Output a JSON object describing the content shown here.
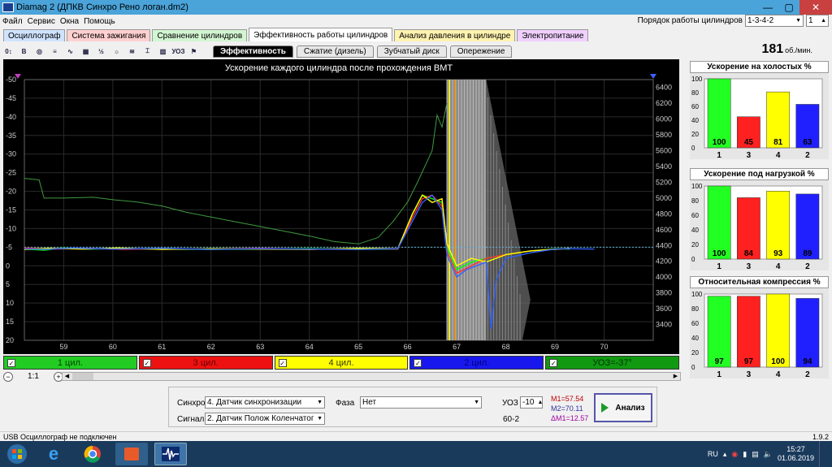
{
  "window": {
    "title": "Diamag 2 (ДПКВ Синхро Рено логан.dm2)"
  },
  "menu": [
    "Файл",
    "Сервис",
    "Окна",
    "Помощь"
  ],
  "order": {
    "label": "Порядок работы цилиндров",
    "value": "1-3-4-2",
    "spin": "1"
  },
  "tabs": [
    {
      "label": "Осциллограф",
      "color": "#cfe3ff"
    },
    {
      "label": "Система зажигания",
      "color": "#ffd0d0"
    },
    {
      "label": "Сравнение цилиндров",
      "color": "#d2f5d2"
    },
    {
      "label": "Эффективность работы цилиндров",
      "color": "#ffffff"
    },
    {
      "label": "Анализ давления в цилиндре",
      "color": "#fff3b0"
    },
    {
      "label": "Электропитание",
      "color": "#f0d0ff"
    }
  ],
  "subtabs": [
    "Эффективность",
    "Сжатие (дизель)",
    "Зубчатый диск",
    "Опережение"
  ],
  "rpm": {
    "value": "181",
    "unit": "об./мин."
  },
  "chart_data": {
    "type": "line",
    "title": "Ускорение каждого цилиндра после прохождения ВМТ",
    "xlim": [
      58.2,
      71
    ],
    "x_ticks": [
      59,
      60,
      61,
      62,
      63,
      64,
      65,
      66,
      67,
      68,
      69,
      70
    ],
    "ylim_left": [
      -50,
      20
    ],
    "y_left_ticks": [
      -50,
      -45,
      -40,
      -35,
      -30,
      -25,
      -20,
      -15,
      -10,
      -5,
      0,
      5,
      10,
      15,
      20
    ],
    "ylim_right": [
      3200,
      6500
    ],
    "y_right_ticks": [
      3400,
      3600,
      3800,
      4000,
      4200,
      4400,
      4600,
      4800,
      5000,
      5200,
      5400,
      5600,
      5800,
      6000,
      6200,
      6400
    ],
    "baseline": -5,
    "series": [
      {
        "name": "1 цил.",
        "color": "#00ff00",
        "x": [
          58.2,
          58.6,
          59.0,
          59.5,
          60.0,
          61.0,
          62.0,
          63.0,
          64.0,
          65.0,
          65.8,
          66.1,
          66.3,
          66.5,
          66.7,
          66.8,
          67.0,
          67.3,
          67.6,
          68.0,
          68.5,
          69.0,
          69.3
        ],
        "y": [
          -4.5,
          -4.2,
          -4.8,
          -4.5,
          -4.6,
          -4.5,
          -4.4,
          -4.5,
          -4.6,
          -4.4,
          -4.5,
          -14,
          -19,
          -18,
          -17,
          -5,
          1,
          -1,
          -2,
          -3,
          -4,
          -4.6,
          -4.5
        ]
      },
      {
        "name": "3 цил.",
        "color": "#ff3030",
        "x": [
          58.2,
          58.8,
          59.5,
          60.2,
          61.0,
          62.0,
          63.0,
          64.0,
          65.0,
          65.8,
          66.1,
          66.3,
          66.5,
          66.7,
          66.8,
          67.0,
          67.3,
          67.6,
          68.0,
          68.5,
          69.0,
          69.3
        ],
        "y": [
          -4.8,
          -4.5,
          -4.7,
          -4.4,
          -4.6,
          -4.5,
          -4.7,
          -4.4,
          -4.6,
          -4.5,
          -13,
          -18,
          -19,
          -16,
          -4,
          2,
          0,
          -2,
          -3,
          -4,
          -4.5,
          -4.6
        ]
      },
      {
        "name": "4 цил.",
        "color": "#ffff00",
        "x": [
          58.2,
          58.7,
          59.4,
          60.1,
          61.0,
          62.0,
          63.0,
          64.0,
          65.0,
          65.8,
          66.1,
          66.3,
          66.5,
          66.7,
          66.8,
          67.0,
          67.3,
          67.6,
          68.0,
          68.5,
          69.0,
          69.3
        ],
        "y": [
          -4.4,
          -4.7,
          -4.5,
          -4.8,
          -4.4,
          -4.6,
          -4.5,
          -4.4,
          -4.7,
          -4.6,
          -14,
          -19,
          -17,
          -18,
          -6,
          0,
          -2,
          -1,
          -3,
          -4,
          -4.4,
          -4.7
        ]
      },
      {
        "name": "2 цил.",
        "color": "#3060ff",
        "x": [
          58.2,
          58.6,
          59.2,
          60.0,
          61.0,
          62.0,
          63.0,
          64.0,
          65.0,
          65.8,
          66.1,
          66.3,
          66.5,
          66.7,
          66.8,
          67.0,
          67.2,
          67.4,
          67.6,
          67.7,
          67.8,
          68.0,
          68.5,
          69.0,
          69.3,
          69.8
        ],
        "y": [
          -4.6,
          -4.4,
          -4.8,
          -4.5,
          -4.7,
          -4.4,
          -4.6,
          -4.5,
          -4.4,
          -4.6,
          -12,
          -17,
          -19,
          -15,
          -3,
          3,
          1,
          0,
          -1,
          17,
          4,
          -2,
          -3.5,
          -4.5,
          -4.6,
          -4.5
        ]
      },
      {
        "name": "rpm",
        "color": "#3f9a3f",
        "x": [
          58.2,
          58.5,
          58.6,
          59.0,
          59.6,
          60.0,
          60.5,
          61.0,
          61.5,
          62.0,
          62.5,
          63.0,
          63.5,
          64.0,
          64.5,
          65.0,
          65.4,
          65.7,
          66.0,
          66.2,
          66.5,
          66.6,
          66.7,
          66.8
        ],
        "y": [
          5250,
          5230,
          5000,
          5000,
          5010,
          4980,
          4950,
          4900,
          4820,
          4760,
          4700,
          4640,
          4580,
          4520,
          4450,
          4420,
          4500,
          4700,
          4950,
          5200,
          5600,
          6050,
          5900,
          6200
        ]
      }
    ],
    "yellow_marker_x": 66.85,
    "orange_marker_x": 66.97,
    "gray_region": [
      66.8,
      68.5
    ]
  },
  "legend": [
    {
      "label": "1 цил.",
      "bg": "#22cc22",
      "fg": "#004400"
    },
    {
      "label": "3 цил.",
      "bg": "#ee1111",
      "fg": "#660000"
    },
    {
      "label": "4 цил.",
      "bg": "#ffff00",
      "fg": "#333300"
    },
    {
      "label": "2 цил.",
      "bg": "#1818ee",
      "fg": "#000080"
    },
    {
      "label": "УОЗ=-37°",
      "bg": "#119911",
      "fg": "#003300"
    }
  ],
  "zoom": {
    "scale": "1:1"
  },
  "panels": [
    {
      "title": "Ускорение на холостых %",
      "values": [
        100,
        45,
        81,
        63
      ]
    },
    {
      "title": "Ускорение под нагрузкой %",
      "values": [
        100,
        84,
        93,
        89
      ]
    },
    {
      "title": "Относительная компрессия %",
      "values": [
        97,
        97,
        100,
        94
      ]
    }
  ],
  "bar_labels": [
    "1",
    "3",
    "4",
    "2"
  ],
  "bar_colors": [
    "#22ff22",
    "#ff2020",
    "#ffff00",
    "#2020ff"
  ],
  "bar_yticks": [
    "100",
    "80",
    "60",
    "40",
    "20",
    "0"
  ],
  "controls": {
    "sync_label": "Синхро:",
    "sync_value": "4. Датчик синхронизации",
    "signal_label": "Сигнал:",
    "signal_value": "2. Датчик Полож Коленчатого Вал",
    "phase_label": "Фаза",
    "phase_value": "Нет",
    "uoz_label": "УОЗ",
    "uoz_value": "-10",
    "teeth": "60-2",
    "m1": "M1=57.54",
    "m2": "M2=70.11",
    "dm": "ΔM1=12.57",
    "analyze": "Анализ"
  },
  "status": {
    "left": "USB Осциллограф не подключен",
    "version": "1.9.2"
  },
  "taskbar": {
    "lang": "RU",
    "time": "15:27",
    "date": "01.06.2019"
  }
}
